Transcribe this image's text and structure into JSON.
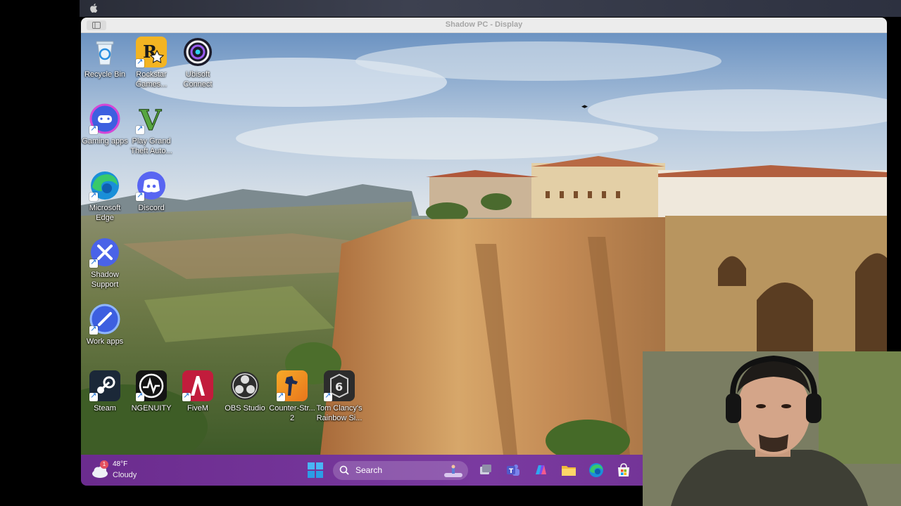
{
  "window": {
    "title": "Shadow PC - Display"
  },
  "desktop_icons": [
    {
      "label": "Recycle Bin",
      "icon": "recycle-bin-icon"
    },
    {
      "label": "Rockstar Games...",
      "icon": "rockstar-games-icon"
    },
    {
      "label": "Ubisoft Connect",
      "icon": "ubisoft-connect-icon"
    },
    {
      "label": "Gaming apps",
      "icon": "gaming-apps-icon"
    },
    {
      "label": "Play Grand Theft Auto...",
      "icon": "gta-v-icon"
    },
    {
      "label": "Microsoft Edge",
      "icon": "edge-icon"
    },
    {
      "label": "Discord",
      "icon": "discord-icon"
    },
    {
      "label": "Shadow Support",
      "icon": "shadow-support-icon"
    },
    {
      "label": "Work apps",
      "icon": "work-apps-icon"
    },
    {
      "label": "Steam",
      "icon": "steam-icon"
    },
    {
      "label": "NGENUITY",
      "icon": "ngenuity-icon"
    },
    {
      "label": "FiveM",
      "icon": "fivem-icon"
    },
    {
      "label": "OBS Studio",
      "icon": "obs-studio-icon"
    },
    {
      "label": "Counter-Str... 2",
      "icon": "counter-strike-icon"
    },
    {
      "label": "Tom Clancy's Rainbow Si...",
      "icon": "rainbow-six-icon"
    }
  ],
  "taskbar": {
    "weather": {
      "badge": "1",
      "temperature": "48°F",
      "condition": "Cloudy"
    },
    "search_label": "Search",
    "pinned": [
      "start-icon",
      "task-view-icon",
      "teams-icon",
      "copilot-icon",
      "file-explorer-icon",
      "edge-icon",
      "store-icon",
      "steam-icon"
    ]
  },
  "colors": {
    "taskbar": "#7a3aa0",
    "titlebar": "#ececec"
  }
}
